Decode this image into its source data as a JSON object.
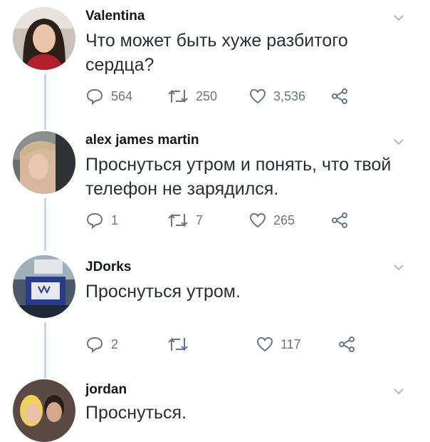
{
  "tweets": [
    {
      "user": "Valentina",
      "text": "Что может быть хуже разбитого сердца?",
      "replies": "564",
      "retweets": "250",
      "likes": "3,536"
    },
    {
      "user": "alex james martin",
      "text": "Проснуться утром и понять, что твой телефон не зарядился.",
      "replies": "1",
      "retweets": "7",
      "likes": "265"
    },
    {
      "user": "JDorks",
      "text": "Проснуться утром.",
      "replies": "2",
      "retweets": "",
      "likes": "117"
    },
    {
      "user": "jordan",
      "text": "Проснуться."
    }
  ],
  "icons": {
    "reply": "reply-icon",
    "retweet": "retweet-icon",
    "like": "heart-icon",
    "share": "share-icon",
    "menu": "chevron-down-icon"
  },
  "colors": {
    "text": "#14171a",
    "muted": "#657786",
    "thread_line": "#ccd6dd"
  }
}
